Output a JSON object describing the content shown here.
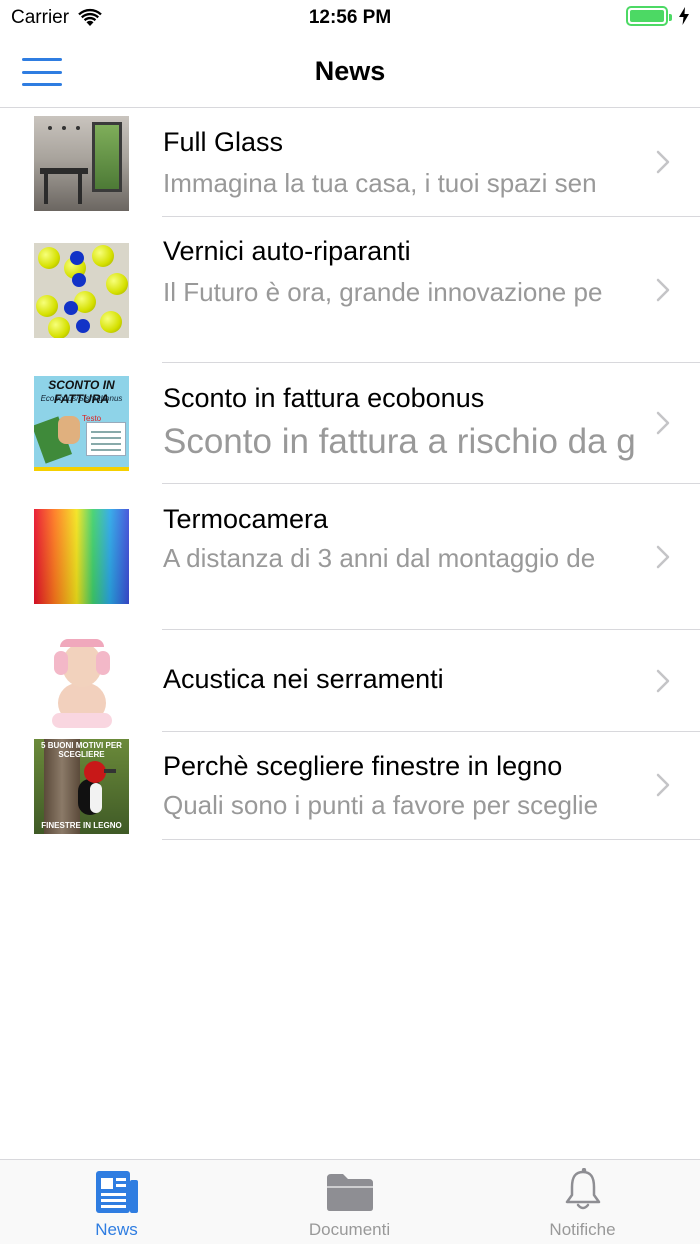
{
  "status_bar": {
    "carrier": "Carrier",
    "time": "12:56 PM"
  },
  "nav": {
    "title": "News"
  },
  "news": [
    {
      "title": "Full Glass",
      "subtitle": "Immagina la tua casa, i tuoi spazi sen",
      "thumb_icon": "interior-glass-photo"
    },
    {
      "title": "Vernici auto-riparanti",
      "subtitle": "Il Futuro è ora, grande innovazione pe",
      "thumb_icon": "tennis-balls-photo"
    },
    {
      "title": "Sconto in fattura ecobonus",
      "subtitle": "Sconto in fattura a rischio da g",
      "thumb_icon": "sconto-infographic",
      "thumb_text": {
        "headline": "SCONTO IN FATTURA",
        "sub": "Ecobonus/Sismabonus",
        "label": "Testo"
      }
    },
    {
      "title": "Termocamera",
      "subtitle": "A distanza di 3 anni dal montaggio de",
      "thumb_icon": "thermal-image-photo"
    },
    {
      "title": "Acustica nei serramenti",
      "subtitle": "",
      "thumb_icon": "baby-headphones-photo"
    },
    {
      "title": "Perchè scegliere finestre in legno",
      "subtitle": "Quali sono i punti a favore per sceglie",
      "thumb_icon": "woodpecker-photo",
      "thumb_text": {
        "top": "5 BUONI MOTIVI PER SCEGLIERE",
        "bottom": "FINESTRE IN LEGNO"
      }
    }
  ],
  "tabs": [
    {
      "label": "News",
      "icon": "newspaper-icon",
      "active": true
    },
    {
      "label": "Documenti",
      "icon": "folder-icon",
      "active": false
    },
    {
      "label": "Notifiche",
      "icon": "bell-icon",
      "active": false
    }
  ],
  "colors": {
    "accent": "#2f7de1",
    "separator": "#d8d8dc",
    "subtitle": "#999999",
    "battery": "#4cd964"
  }
}
